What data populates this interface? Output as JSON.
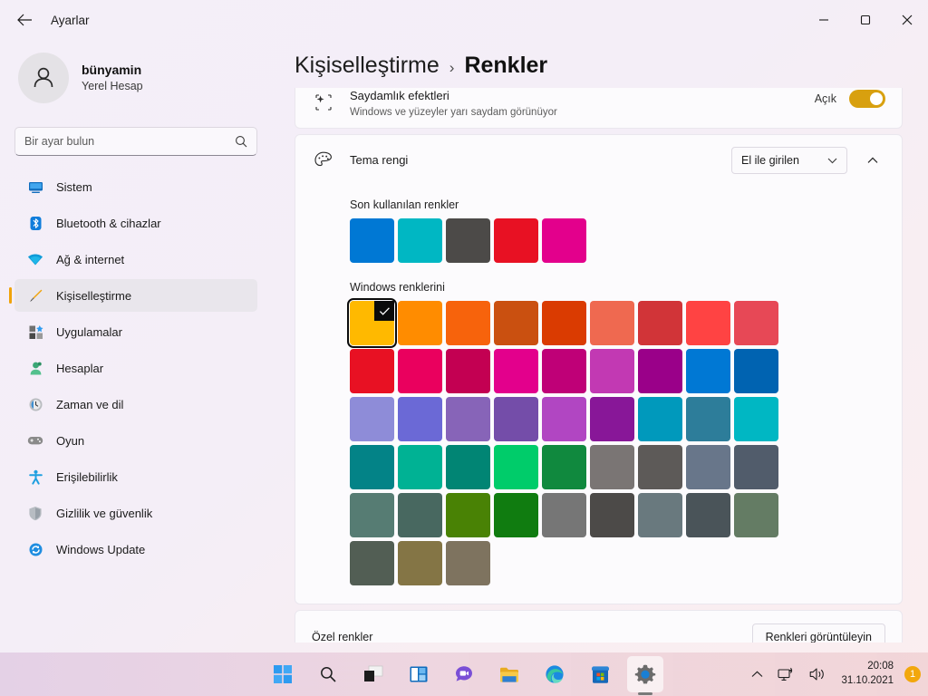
{
  "window": {
    "app_title": "Ayarlar",
    "back_icon": "arrow-left-icon",
    "minimize_label": "—",
    "maximize_label": "❐",
    "close_label": "✕"
  },
  "profile": {
    "name": "bünyamin",
    "account_type": "Yerel Hesap"
  },
  "search": {
    "placeholder": "Bir ayar bulun",
    "value": "",
    "icon": "search-icon"
  },
  "sidebar": {
    "items": [
      {
        "label": "Sistem",
        "icon": "monitor-icon",
        "active": false
      },
      {
        "label": "Bluetooth & cihazlar",
        "icon": "bluetooth-icon",
        "active": false
      },
      {
        "label": "Ağ & internet",
        "icon": "wifi-icon",
        "active": false
      },
      {
        "label": "Kişiselleştirme",
        "icon": "brush-icon",
        "active": true
      },
      {
        "label": "Uygulamalar",
        "icon": "apps-icon",
        "active": false
      },
      {
        "label": "Hesaplar",
        "icon": "person-icon",
        "active": false
      },
      {
        "label": "Zaman ve dil",
        "icon": "clock-globe-icon",
        "active": false
      },
      {
        "label": "Oyun",
        "icon": "gamepad-icon",
        "active": false
      },
      {
        "label": "Erişilebilirlik",
        "icon": "accessibility-icon",
        "active": false
      },
      {
        "label": "Gizlilik ve güvenlik",
        "icon": "shield-icon",
        "active": false
      },
      {
        "label": "Windows Update",
        "icon": "update-icon",
        "active": false
      }
    ]
  },
  "breadcrumb": {
    "parent": "Kişiselleştirme",
    "separator": "›",
    "current": "Renkler"
  },
  "transparency": {
    "icon": "sparkle-icon",
    "title": "Saydamlık efektleri",
    "subtitle": "Windows ve yüzeyler yarı saydam görünüyor",
    "state_label": "Açık",
    "enabled": true,
    "accent_color": "#d8a00f"
  },
  "accent": {
    "icon": "palette-icon",
    "title": "Tema rengi",
    "dropdown_value": "El ile girilen",
    "dropdown_chevron": "chevron-down-icon",
    "expander_chevron": "chevron-up-icon",
    "expanded": true,
    "recent_label": "Son kullanılan renkler",
    "recent_colors": [
      "#0078D4",
      "#00B7C3",
      "#4C4A48",
      "#E81123",
      "#E3008C"
    ],
    "windows_label": "Windows renklerini",
    "selected_index": 0,
    "check_icon": "check-icon",
    "windows_colors": [
      [
        "#FFB900",
        "#FF8C00",
        "#F7630C",
        "#CA5010",
        "#DA3B01",
        "#EF6950",
        "#D13438",
        "#FF4343",
        "#E74856"
      ],
      [
        "#E81123",
        "#EA005E",
        "#C30052",
        "#E3008C",
        "#BF0077",
        "#C239B3",
        "#9A0089",
        "#0078D4",
        "#0063B1"
      ],
      [
        "#8E8CD8",
        "#6B69D6",
        "#8764B8",
        "#744DA9",
        "#B146C2",
        "#881798",
        "#0099BC",
        "#2D7D9A",
        "#00B7C3"
      ],
      [
        "#038387",
        "#00B294",
        "#018574",
        "#00CC6A",
        "#10893E",
        "#7A7574",
        "#5D5A58",
        "#68768A",
        "#515C6B"
      ],
      [
        "#567C73",
        "#486860",
        "#498205",
        "#107C10",
        "#767676",
        "#4C4A48",
        "#69797E",
        "#4A5459",
        "#647C64"
      ],
      [
        "#525E54",
        "#847545",
        "#7E735F"
      ]
    ],
    "custom_label": "Özel renkler",
    "custom_button": "Renkleri görüntüleyin"
  },
  "taskbar": {
    "items": [
      {
        "name": "start-button",
        "icon": "windows-logo-icon",
        "active": false
      },
      {
        "name": "search-button",
        "icon": "search-icon",
        "active": false
      },
      {
        "name": "task-view-button",
        "icon": "task-view-icon",
        "active": false
      },
      {
        "name": "widgets-button",
        "icon": "widgets-icon",
        "active": false
      },
      {
        "name": "chat-button",
        "icon": "chat-icon",
        "active": false
      },
      {
        "name": "file-explorer-button",
        "icon": "folder-icon",
        "active": false
      },
      {
        "name": "edge-button",
        "icon": "edge-icon",
        "active": false
      },
      {
        "name": "store-button",
        "icon": "store-icon",
        "active": false
      },
      {
        "name": "settings-button",
        "icon": "gear-icon",
        "active": true
      }
    ],
    "tray": {
      "chevron": "chevron-up-icon",
      "network": "network-icon",
      "volume": "volume-icon",
      "time": "20:08",
      "date": "31.10.2021",
      "notification_count": "1",
      "badge_color": "#f2a70c"
    }
  }
}
